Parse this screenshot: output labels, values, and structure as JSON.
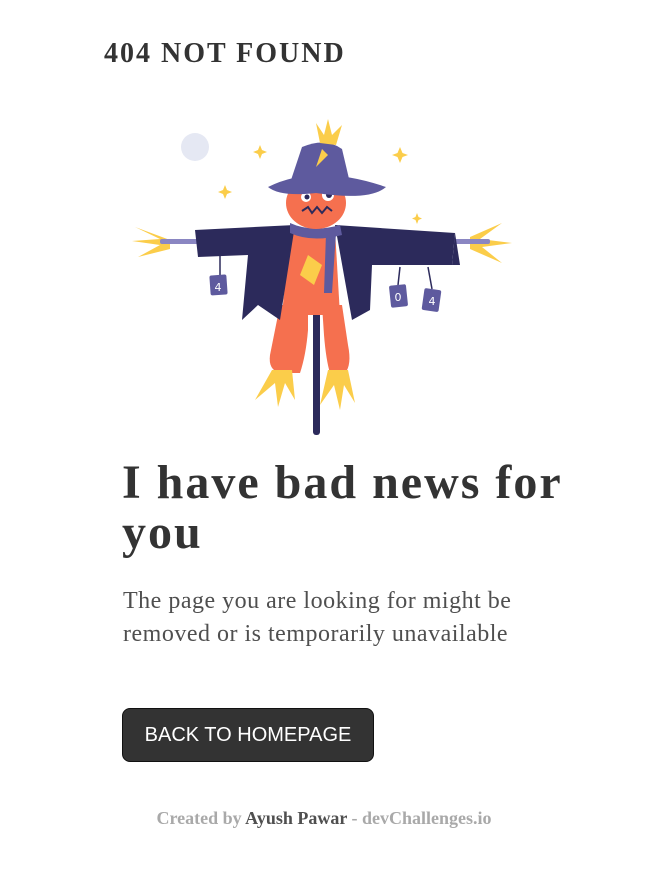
{
  "header": {
    "brand": "404 NOT FOUND"
  },
  "illustration": {
    "icon": "scarecrow-illustration",
    "can_labels": [
      "4",
      "0",
      "4"
    ]
  },
  "main": {
    "headline": "I have bad news for you",
    "description": "The page you are looking for might be removed or is temporarily unavailable",
    "button_label": "BACK TO HOMEPAGE"
  },
  "footer": {
    "prefix": "Created by",
    "author": "Ayush Pawar",
    "separator": "-",
    "site": "devChallenges.io"
  },
  "colors": {
    "text_dark": "#333333",
    "text_body": "#4f4f4f",
    "footer_gray": "#a9a9a9",
    "hat_purple": "#5e5a9e",
    "coat_navy": "#2c2a5b",
    "face_orange": "#f5704f",
    "straw_yellow": "#fbcd4a"
  }
}
